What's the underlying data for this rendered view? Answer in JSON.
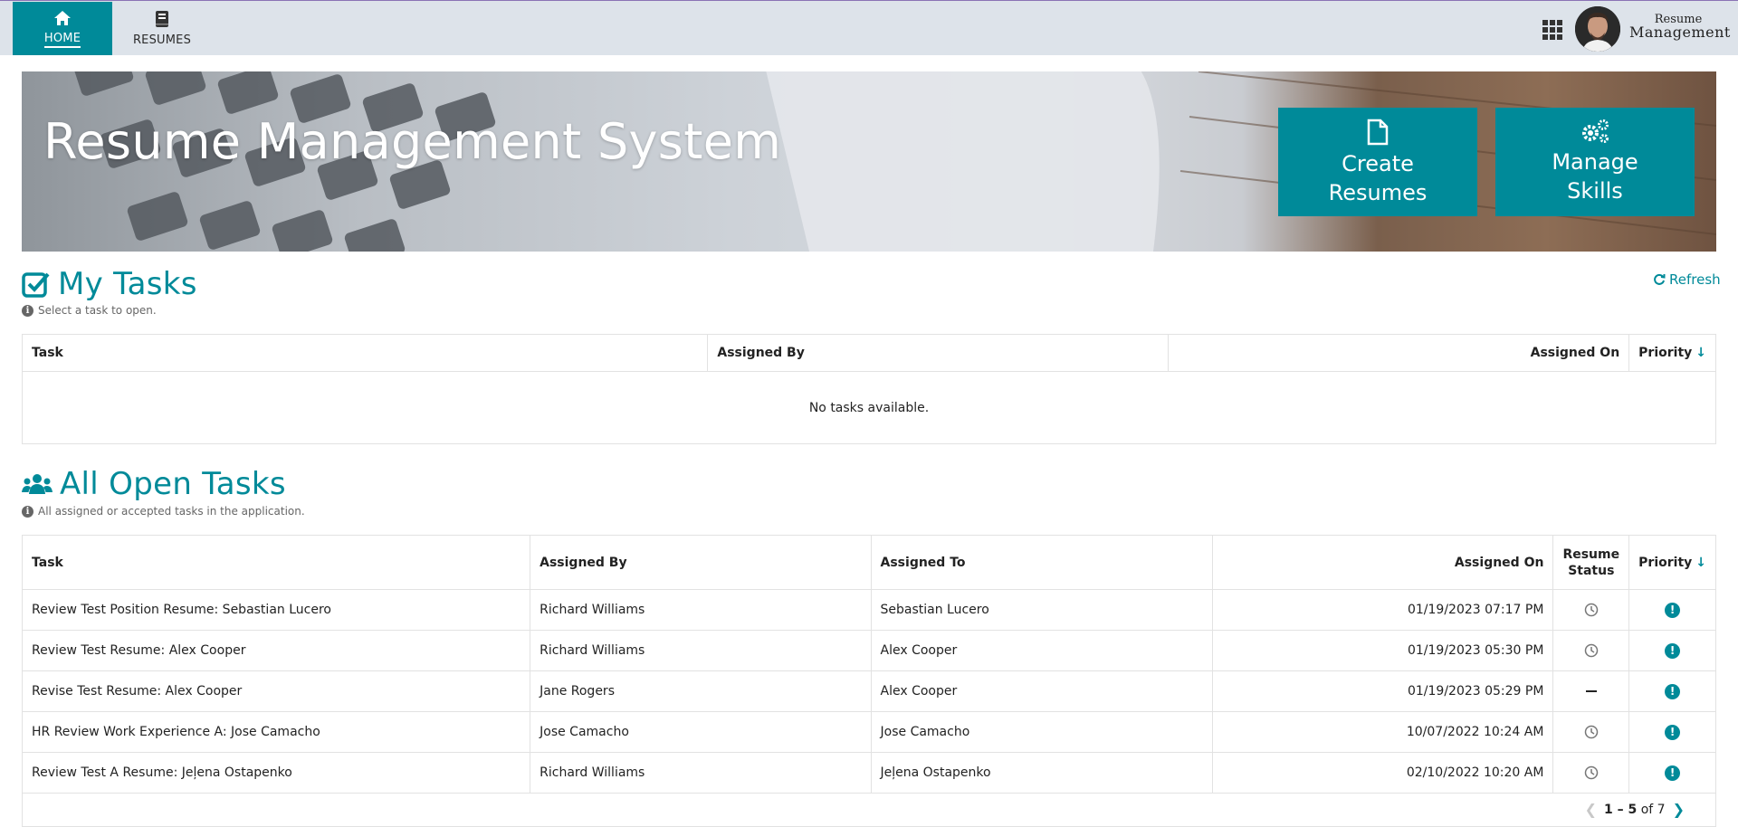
{
  "nav": {
    "tabs": [
      {
        "label": "HOME",
        "icon": "home-icon",
        "active": true
      },
      {
        "label": "RESUMES",
        "icon": "book-icon",
        "active": false
      }
    ],
    "brand_line1": "Resume",
    "brand_line2": "Management"
  },
  "banner": {
    "title": "Resume Management System",
    "actions": [
      {
        "line1": "Create",
        "line2": "Resumes",
        "icon": "file-icon"
      },
      {
        "line1": "Manage",
        "line2": "Skills",
        "icon": "gears-icon"
      }
    ]
  },
  "my_tasks": {
    "heading": "My Tasks",
    "hint": "Select a task to open.",
    "refresh_label": "Refresh",
    "columns": {
      "task": "Task",
      "assigned_by": "Assigned By",
      "assigned_on": "Assigned On",
      "priority": "Priority"
    },
    "empty_message": "No tasks available."
  },
  "all_open_tasks": {
    "heading": "All Open Tasks",
    "hint": "All assigned or accepted tasks in the application.",
    "columns": {
      "task": "Task",
      "assigned_by": "Assigned By",
      "assigned_to": "Assigned To",
      "assigned_on": "Assigned On",
      "resume_status_1": "Resume",
      "resume_status_2": "Status",
      "priority": "Priority"
    },
    "rows": [
      {
        "task": "Review Test Position Resume: Sebastian Lucero",
        "assigned_by": "Richard Williams",
        "assigned_to": "Sebastian Lucero",
        "assigned_on": "01/19/2023 07:17 PM",
        "status": "clock",
        "priority": "!"
      },
      {
        "task": "Review Test Resume: Alex Cooper",
        "assigned_by": "Richard Williams",
        "assigned_to": "Alex Cooper",
        "assigned_on": "01/19/2023 05:30 PM",
        "status": "clock",
        "priority": "!"
      },
      {
        "task": "Revise Test Resume: Alex Cooper",
        "assigned_by": "Jane Rogers",
        "assigned_to": "Alex Cooper",
        "assigned_on": "01/19/2023 05:29 PM",
        "status": "dash",
        "priority": "!"
      },
      {
        "task": "HR Review Work Experience A: Jose Camacho",
        "assigned_by": "Jose Camacho",
        "assigned_to": "Jose Camacho",
        "assigned_on": "10/07/2022 10:24 AM",
        "status": "clock",
        "priority": "!"
      },
      {
        "task": "Review Test A Resume: Jeļena Ostapenko",
        "assigned_by": "Richard Williams",
        "assigned_to": "Jeļena Ostapenko",
        "assigned_on": "02/10/2022 10:20 AM",
        "status": "clock",
        "priority": "!"
      }
    ],
    "pager": {
      "range": "1 – 5",
      "of": "of 7"
    }
  },
  "colors": {
    "accent": "#008a99",
    "nav_bg": "#dde3ea"
  }
}
